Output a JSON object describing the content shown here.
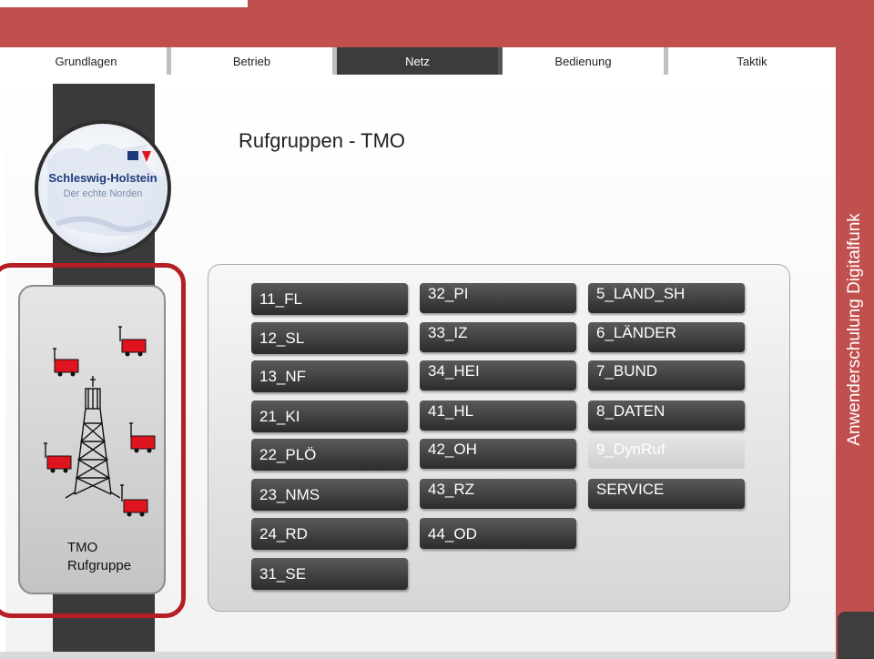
{
  "tabs": [
    {
      "label": "Grundlagen",
      "active": false
    },
    {
      "label": "Betrieb",
      "active": false
    },
    {
      "label": "Netz",
      "active": true
    },
    {
      "label": "Bedienung",
      "active": false
    },
    {
      "label": "Taktik",
      "active": false
    }
  ],
  "logo": {
    "line1": "Schleswig-Holstein",
    "line2": "Der echte Norden"
  },
  "page_title": "Rufgruppen - TMO",
  "side_label": "Anwenderschulung Digitalfunk",
  "selected_item": {
    "line1": "TMO",
    "line2": "Rufgruppe",
    "icon": "tower-vehicles-icon"
  },
  "groups": {
    "col1": [
      "11_FL",
      "12_SL",
      "13_NF",
      "21_KI",
      "22_PLÖ",
      "23_NMS",
      "24_RD",
      "31_SE"
    ],
    "col2": [
      "32_PI",
      "33_IZ",
      "34_HEI",
      "41_HL",
      "42_OH",
      "43_RZ",
      "44_OD"
    ],
    "col3": [
      "5_LAND_SH",
      "6_LÄNDER",
      "7_BUND",
      "8_DATEN",
      "9_DynRuf",
      "SERVICE"
    ],
    "disabled": [
      "9_DynRuf"
    ]
  },
  "colors": {
    "accent": "#c0504d",
    "selection": "#b51f24",
    "button": "#3c3c3c",
    "vehicle": "#e0141e"
  }
}
